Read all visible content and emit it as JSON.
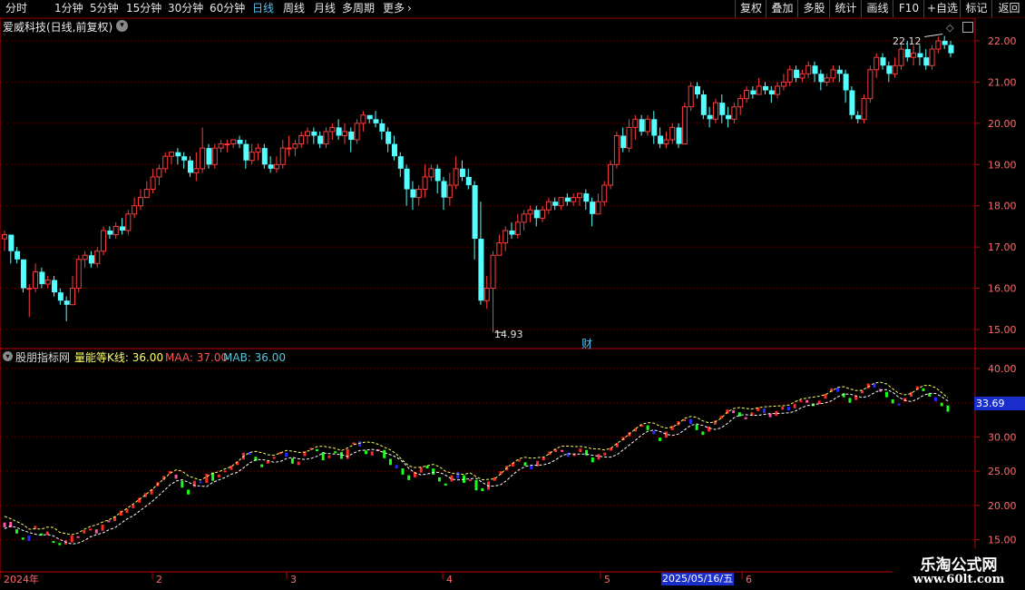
{
  "toolbar": {
    "periods": [
      "分时",
      "1分钟",
      "5分钟",
      "15分钟",
      "30分钟",
      "60分钟",
      "日线",
      "周线",
      "月线",
      "多周期",
      "更多"
    ],
    "active_period": "日线",
    "right_buttons": [
      "复权",
      "叠加",
      "多股",
      "统计",
      "画线",
      "F10",
      "+自选",
      "返回"
    ]
  },
  "main_chart": {
    "title": "爱威科技(日线,前复权)",
    "y_ticks": [
      "22.00",
      "21.00",
      "20.00",
      "19.00",
      "18.00",
      "17.00",
      "16.00",
      "15.00"
    ],
    "high_marker": "22.12",
    "low_marker": "14.93",
    "finance_marker": "财"
  },
  "indicator": {
    "name": "股朋指标网",
    "line_label": "量能等K线: 36.00",
    "maa_label": "MAA: 37.00",
    "mab_label": "MAB: 36.00",
    "y_ticks": [
      "40.00",
      "35.00",
      "30.00",
      "25.00",
      "20.00",
      "15.00"
    ],
    "current_value": "33.69"
  },
  "x_axis": {
    "labels": [
      "2024年",
      "2",
      "3",
      "4",
      "5",
      "6"
    ],
    "cursor_date": "2025/05/16/五"
  },
  "watermark": {
    "title": "乐淘公式网",
    "url": "www.60lt.com"
  },
  "colors": {
    "up": "#ff3c3c",
    "down": "#54ffff",
    "grid": "#7a0000",
    "axis": "#c00000",
    "ind_up": "#ff2a2a",
    "ind_down": "#19ff19",
    "ind_pink": "#ff55a8",
    "ind_blue": "#2a2aff",
    "maa": "#ffff66",
    "mab": "#ffffff"
  },
  "chart_data": {
    "type": "candlestick",
    "price_ylim": [
      14.75,
      22.4
    ],
    "indicator_ylim": [
      12,
      42
    ],
    "price_series": [
      [
        17.2,
        17.3,
        17.4,
        16.9
      ],
      [
        17.3,
        16.9,
        17.1,
        16.6
      ],
      [
        16.9,
        16.7,
        17.0,
        16.6
      ],
      [
        16.7,
        16.0,
        16.7,
        15.9
      ],
      [
        16.0,
        16.0,
        16.1,
        15.3
      ],
      [
        16.0,
        16.4,
        16.6,
        15.9
      ],
      [
        16.4,
        16.1,
        16.5,
        16.0
      ],
      [
        16.1,
        16.2,
        16.3,
        16.0
      ],
      [
        16.2,
        15.9,
        16.3,
        15.8
      ],
      [
        15.9,
        15.7,
        16.0,
        15.6
      ],
      [
        15.7,
        15.6,
        15.8,
        15.2
      ],
      [
        15.6,
        16.0,
        16.3,
        15.6
      ],
      [
        16.0,
        16.7,
        16.8,
        15.9
      ],
      [
        16.7,
        16.8,
        16.9,
        16.5
      ],
      [
        16.8,
        16.6,
        16.9,
        16.5
      ],
      [
        16.6,
        16.9,
        17.0,
        16.5
      ],
      [
        16.9,
        17.4,
        17.5,
        16.8
      ],
      [
        17.4,
        17.3,
        17.5,
        17.2
      ],
      [
        17.3,
        17.5,
        17.6,
        17.2
      ],
      [
        17.5,
        17.4,
        17.7,
        17.3
      ],
      [
        17.4,
        17.8,
        17.9,
        17.3
      ],
      [
        17.8,
        18.0,
        18.2,
        17.7
      ],
      [
        18.0,
        18.2,
        18.4,
        17.9
      ],
      [
        18.2,
        18.4,
        18.6,
        18.2
      ],
      [
        18.4,
        18.7,
        18.9,
        18.3
      ],
      [
        18.7,
        18.9,
        19.0,
        18.5
      ],
      [
        18.9,
        19.2,
        19.3,
        18.8
      ],
      [
        19.2,
        19.3,
        19.3,
        19.0
      ],
      [
        19.3,
        19.2,
        19.4,
        19.0
      ],
      [
        19.2,
        19.1,
        19.3,
        18.9
      ],
      [
        19.1,
        18.8,
        19.2,
        18.7
      ],
      [
        18.8,
        18.9,
        19.3,
        18.6
      ],
      [
        18.9,
        19.4,
        19.9,
        18.8
      ],
      [
        19.4,
        19.0,
        19.5,
        18.9
      ],
      [
        19.0,
        19.4,
        19.5,
        18.9
      ],
      [
        19.4,
        19.5,
        19.6,
        19.3
      ],
      [
        19.5,
        19.5,
        19.6,
        19.3
      ],
      [
        19.5,
        19.6,
        19.6,
        19.4
      ],
      [
        19.6,
        19.5,
        19.7,
        19.4
      ],
      [
        19.5,
        19.1,
        19.6,
        18.9
      ],
      [
        19.1,
        19.3,
        19.5,
        19.0
      ],
      [
        19.3,
        19.4,
        19.5,
        19.1
      ],
      [
        19.4,
        19.0,
        19.5,
        18.9
      ],
      [
        19.0,
        18.9,
        19.2,
        18.8
      ],
      [
        18.9,
        19.0,
        19.2,
        18.8
      ],
      [
        19.0,
        19.4,
        19.6,
        18.9
      ],
      [
        19.4,
        19.4,
        19.7,
        19.2
      ],
      [
        19.4,
        19.5,
        19.6,
        19.2
      ],
      [
        19.5,
        19.7,
        19.8,
        19.4
      ],
      [
        19.7,
        19.8,
        19.9,
        19.5
      ],
      [
        19.8,
        19.7,
        19.9,
        19.5
      ],
      [
        19.7,
        19.5,
        19.8,
        19.4
      ],
      [
        19.5,
        19.8,
        19.9,
        19.4
      ],
      [
        19.8,
        19.9,
        20.0,
        19.6
      ],
      [
        19.9,
        19.7,
        20.1,
        19.6
      ],
      [
        19.7,
        19.8,
        20.0,
        19.5
      ],
      [
        19.8,
        19.6,
        19.9,
        19.3
      ],
      [
        19.6,
        20.0,
        20.1,
        19.5
      ],
      [
        20.0,
        20.2,
        20.3,
        19.8
      ],
      [
        20.2,
        20.1,
        20.2,
        20.0
      ],
      [
        20.1,
        20.0,
        20.3,
        19.9
      ],
      [
        20.0,
        19.8,
        20.1,
        19.6
      ],
      [
        19.8,
        19.5,
        19.9,
        19.3
      ],
      [
        19.5,
        19.2,
        19.7,
        19.1
      ],
      [
        19.2,
        18.9,
        19.3,
        18.7
      ],
      [
        18.9,
        18.4,
        19.0,
        18.0
      ],
      [
        18.4,
        18.2,
        18.6,
        17.9
      ],
      [
        18.2,
        18.4,
        18.5,
        18.0
      ],
      [
        18.4,
        18.7,
        19.0,
        18.2
      ],
      [
        18.7,
        18.9,
        19.0,
        18.6
      ],
      [
        18.9,
        18.6,
        19.0,
        18.3
      ],
      [
        18.6,
        18.2,
        18.7,
        17.9
      ],
      [
        18.2,
        18.5,
        18.8,
        18.0
      ],
      [
        18.5,
        18.9,
        19.2,
        18.4
      ],
      [
        18.9,
        18.7,
        19.1,
        18.6
      ],
      [
        18.7,
        18.5,
        18.9,
        18.4
      ],
      [
        18.5,
        17.2,
        18.6,
        16.7
      ],
      [
        17.2,
        15.7,
        18.1,
        15.6
      ],
      [
        15.7,
        16.0,
        16.3,
        15.5
      ],
      [
        16.0,
        16.8,
        16.9,
        14.93
      ],
      [
        16.8,
        17.1,
        17.3,
        16.8
      ],
      [
        17.1,
        17.4,
        17.5,
        16.9
      ],
      [
        17.4,
        17.3,
        17.6,
        17.2
      ],
      [
        17.3,
        17.6,
        17.8,
        17.2
      ],
      [
        17.6,
        17.8,
        17.9,
        17.4
      ],
      [
        17.8,
        17.9,
        18.0,
        17.6
      ],
      [
        17.9,
        17.7,
        18.0,
        17.5
      ],
      [
        17.7,
        17.9,
        18.0,
        17.6
      ],
      [
        17.9,
        18.1,
        18.2,
        17.8
      ],
      [
        18.1,
        18.0,
        18.2,
        17.9
      ],
      [
        18.0,
        18.2,
        18.2,
        17.9
      ],
      [
        18.2,
        18.1,
        18.3,
        18.0
      ],
      [
        18.1,
        18.2,
        18.3,
        18.0
      ],
      [
        18.2,
        18.3,
        18.3,
        18.0
      ],
      [
        18.3,
        18.1,
        18.4,
        17.9
      ],
      [
        18.1,
        17.8,
        18.2,
        17.5
      ],
      [
        17.8,
        18.1,
        18.3,
        17.8
      ],
      [
        18.1,
        18.5,
        18.6,
        18.0
      ],
      [
        18.5,
        19.0,
        19.1,
        18.4
      ],
      [
        19.0,
        19.7,
        19.8,
        18.9
      ],
      [
        19.7,
        19.4,
        19.9,
        19.3
      ],
      [
        19.4,
        19.9,
        20.1,
        19.3
      ],
      [
        19.9,
        20.1,
        20.2,
        19.6
      ],
      [
        20.1,
        19.8,
        20.2,
        19.7
      ],
      [
        19.8,
        20.1,
        20.2,
        19.7
      ],
      [
        20.1,
        19.7,
        20.3,
        19.5
      ],
      [
        19.7,
        19.5,
        19.9,
        19.4
      ],
      [
        19.5,
        19.6,
        19.8,
        19.4
      ],
      [
        19.6,
        19.9,
        20.0,
        19.5
      ],
      [
        19.9,
        19.5,
        20.0,
        19.4
      ],
      [
        19.5,
        20.4,
        20.5,
        19.5
      ],
      [
        20.4,
        20.9,
        21.0,
        20.3
      ],
      [
        20.9,
        20.7,
        21.0,
        20.6
      ],
      [
        20.7,
        20.2,
        20.8,
        20.1
      ],
      [
        20.2,
        20.1,
        20.4,
        19.9
      ],
      [
        20.1,
        20.5,
        20.6,
        20.0
      ],
      [
        20.5,
        20.2,
        20.7,
        20.0
      ],
      [
        20.2,
        20.1,
        20.4,
        19.9
      ],
      [
        20.1,
        20.4,
        20.5,
        20.0
      ],
      [
        20.4,
        20.6,
        20.7,
        20.2
      ],
      [
        20.6,
        20.8,
        20.9,
        20.5
      ],
      [
        20.8,
        20.7,
        20.9,
        20.6
      ],
      [
        20.7,
        20.9,
        21.1,
        20.7
      ],
      [
        20.9,
        20.8,
        21.0,
        20.7
      ],
      [
        20.8,
        20.7,
        20.9,
        20.5
      ],
      [
        20.7,
        20.9,
        21.0,
        20.6
      ],
      [
        20.9,
        21.0,
        21.2,
        20.8
      ],
      [
        21.0,
        21.3,
        21.4,
        20.9
      ],
      [
        21.3,
        21.1,
        21.4,
        21.0
      ],
      [
        21.1,
        21.2,
        21.3,
        21.0
      ],
      [
        21.2,
        21.4,
        21.5,
        21.1
      ],
      [
        21.4,
        21.2,
        21.5,
        21.0
      ],
      [
        21.2,
        21.0,
        21.3,
        20.8
      ],
      [
        21.0,
        21.1,
        21.2,
        20.9
      ],
      [
        21.1,
        21.3,
        21.4,
        21.0
      ],
      [
        21.3,
        21.2,
        21.4,
        21.0
      ],
      [
        21.2,
        20.8,
        21.3,
        20.5
      ],
      [
        20.8,
        20.2,
        20.9,
        20.1
      ],
      [
        20.2,
        20.1,
        20.3,
        20.0
      ],
      [
        20.1,
        20.6,
        20.7,
        20.0
      ],
      [
        20.6,
        21.3,
        21.4,
        20.5
      ],
      [
        21.3,
        21.6,
        21.7,
        21.1
      ],
      [
        21.6,
        21.4,
        21.7,
        21.3
      ],
      [
        21.4,
        21.2,
        21.5,
        21.0
      ],
      [
        21.2,
        21.4,
        21.6,
        21.1
      ],
      [
        21.4,
        21.8,
        21.9,
        21.3
      ],
      [
        21.8,
        21.6,
        22.0,
        21.5
      ],
      [
        21.6,
        21.7,
        21.9,
        21.4
      ],
      [
        21.7,
        21.6,
        21.9,
        21.4
      ],
      [
        21.6,
        21.4,
        21.8,
        21.3
      ],
      [
        21.4,
        21.8,
        21.9,
        21.3
      ],
      [
        21.8,
        22.0,
        22.1,
        21.7
      ],
      [
        22.0,
        21.9,
        22.12,
        21.8
      ],
      [
        21.9,
        21.7,
        22.0,
        21.6
      ]
    ],
    "indicator_series": [
      [
        16.8,
        17.5
      ],
      [
        17.6,
        16.8
      ],
      [
        16.5,
        15.9
      ],
      [
        15.3,
        15.0
      ],
      [
        15.6,
        14.8
      ],
      [
        16.6,
        17.0
      ],
      [
        15.9,
        15.7
      ],
      [
        15.7,
        16.2
      ],
      [
        14.8,
        14.6
      ],
      [
        14.5,
        14.2
      ],
      [
        14.3,
        14.9
      ],
      [
        14.6,
        15.6
      ],
      [
        15.4,
        15.5
      ],
      [
        15.9,
        16.4
      ],
      [
        16.5,
        16.6
      ],
      [
        15.9,
        16.5
      ],
      [
        16.3,
        17.2
      ],
      [
        17.8,
        17.6
      ],
      [
        17.7,
        18.4
      ],
      [
        18.5,
        19.2
      ],
      [
        18.9,
        19.5
      ],
      [
        19.6,
        20.1
      ],
      [
        20.4,
        21.1
      ],
      [
        21.2,
        21.8
      ],
      [
        21.6,
        22.4
      ],
      [
        22.8,
        23.4
      ],
      [
        23.7,
        24.3
      ],
      [
        24.6,
        25.0
      ],
      [
        23.9,
        24.5
      ],
      [
        23.6,
        22.6
      ],
      [
        22.3,
        21.6
      ],
      [
        22.7,
        23.6
      ],
      [
        23.5,
        23.4
      ],
      [
        23.3,
        24.6
      ],
      [
        24.8,
        23.6
      ],
      [
        24.1,
        24.5
      ],
      [
        24.9,
        25.1
      ],
      [
        25.2,
        25.8
      ],
      [
        25.9,
        26.4
      ],
      [
        26.7,
        27.7
      ],
      [
        27.8,
        27.4
      ],
      [
        27.1,
        26.5
      ],
      [
        26.0,
        25.6
      ],
      [
        26.1,
        26.5
      ],
      [
        26.8,
        27.1
      ],
      [
        27.5,
        27.8
      ],
      [
        27.7,
        27.1
      ],
      [
        26.9,
        26.1
      ],
      [
        25.9,
        26.4
      ],
      [
        27.2,
        27.9
      ],
      [
        28.2,
        28.4
      ],
      [
        28.2,
        28.1
      ],
      [
        27.8,
        26.6
      ],
      [
        26.9,
        27.3
      ],
      [
        27.9,
        27.7
      ],
      [
        27.8,
        26.8
      ],
      [
        26.8,
        28.2
      ],
      [
        28.9,
        29.2
      ],
      [
        29.4,
        28.6
      ],
      [
        28.0,
        27.5
      ],
      [
        27.3,
        27.9
      ],
      [
        28.2,
        28.1
      ],
      [
        28.1,
        26.9
      ],
      [
        26.8,
        25.9
      ],
      [
        25.9,
        25.4
      ],
      [
        25.4,
        24.5
      ],
      [
        24.4,
        23.7
      ],
      [
        24.1,
        24.9
      ],
      [
        24.8,
        25.6
      ],
      [
        25.8,
        25.4
      ],
      [
        25.4,
        24.5
      ],
      [
        24.1,
        23.5
      ],
      [
        23.2,
        22.9
      ],
      [
        23.5,
        24.4
      ],
      [
        24.9,
        23.9
      ],
      [
        24.4,
        23.3
      ],
      [
        23.6,
        23.8
      ],
      [
        23.7,
        22.2
      ],
      [
        22.5,
        22.1
      ],
      [
        22.3,
        23.5
      ],
      [
        23.6,
        24.1
      ],
      [
        24.5,
        25.0
      ],
      [
        25.1,
        25.8
      ],
      [
        25.7,
        26.2
      ],
      [
        26.4,
        26.7
      ],
      [
        26.3,
        25.8
      ],
      [
        25.9,
        25.3
      ],
      [
        25.7,
        26.5
      ],
      [
        26.6,
        27.0
      ],
      [
        27.4,
        27.9
      ],
      [
        27.8,
        28.2
      ],
      [
        28.1,
        27.9
      ],
      [
        27.7,
        27.1
      ],
      [
        27.2,
        27.6
      ],
      [
        27.8,
        28.3
      ],
      [
        28.1,
        27.3
      ],
      [
        27.0,
        26.3
      ],
      [
        26.7,
        27.5
      ],
      [
        27.3,
        27.7
      ],
      [
        28.0,
        28.4
      ],
      [
        28.5,
        29.1
      ],
      [
        29.5,
        30.0
      ],
      [
        30.1,
        30.7
      ],
      [
        30.8,
        31.3
      ],
      [
        31.5,
        31.8
      ],
      [
        31.7,
        31.0
      ],
      [
        30.9,
        30.4
      ],
      [
        29.9,
        29.4
      ],
      [
        29.9,
        30.8
      ],
      [
        31.0,
        31.6
      ],
      [
        31.7,
        32.3
      ],
      [
        32.3,
        32.6
      ],
      [
        32.6,
        31.9
      ],
      [
        31.8,
        31.0
      ],
      [
        30.8,
        30.3
      ],
      [
        30.8,
        31.5
      ],
      [
        31.8,
        32.4
      ],
      [
        32.7,
        33.1
      ],
      [
        33.4,
        34.0
      ],
      [
        33.9,
        33.5
      ],
      [
        33.6,
        33.0
      ],
      [
        32.9,
        32.6
      ],
      [
        33.1,
        33.6
      ],
      [
        33.8,
        34.3
      ],
      [
        34.2,
        33.5
      ],
      [
        33.4,
        32.9
      ],
      [
        33.1,
        33.8
      ],
      [
        34.0,
        34.4
      ],
      [
        34.4,
        33.9
      ],
      [
        34.2,
        34.8
      ],
      [
        35.1,
        35.4
      ],
      [
        35.4,
        35.0
      ],
      [
        34.9,
        34.5
      ],
      [
        34.8,
        35.3
      ],
      [
        35.6,
        36.3
      ],
      [
        36.6,
        37.1
      ],
      [
        37.2,
        36.6
      ],
      [
        36.4,
        35.8
      ],
      [
        35.7,
        35.0
      ],
      [
        35.4,
        36.1
      ],
      [
        36.4,
        36.8
      ],
      [
        37.1,
        37.8
      ],
      [
        37.8,
        37.2
      ],
      [
        37.0,
        36.6
      ],
      [
        36.6,
        35.8
      ],
      [
        35.5,
        34.9
      ],
      [
        34.9,
        34.6
      ],
      [
        35.2,
        35.7
      ],
      [
        35.9,
        36.6
      ],
      [
        36.9,
        37.4
      ],
      [
        37.1,
        36.7
      ],
      [
        36.4,
        35.9
      ],
      [
        35.8,
        35.2
      ],
      [
        35.0,
        34.5
      ],
      [
        34.6,
        33.69
      ]
    ]
  }
}
